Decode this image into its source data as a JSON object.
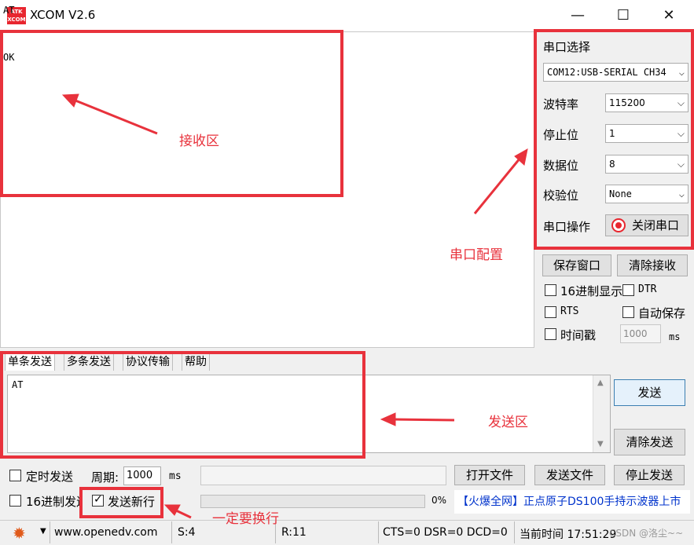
{
  "window": {
    "title": "XCOM V2.6",
    "logo_text": "ATK\nXCOM",
    "minimize": "—",
    "maximize": "☐",
    "close": "✕"
  },
  "receive": {
    "text": "AT\n\n\n\nOK"
  },
  "serial": {
    "port_label": "串口选择",
    "port_value": "COM12:USB-SERIAL CH34",
    "baud_label": "波特率",
    "baud_value": "115200",
    "stop_label": "停止位",
    "stop_value": "1",
    "data_label": "数据位",
    "data_value": "8",
    "parity_label": "校验位",
    "parity_value": "None",
    "op_label": "串口操作",
    "op_button": "关闭串口"
  },
  "receive_controls": {
    "save_window": "保存窗口",
    "clear_receive": "清除接收",
    "hex_display": "16进制显示",
    "dtr": "DTR",
    "rts": "RTS",
    "auto_save": "自动保存",
    "timestamp": "时间戳",
    "timestamp_value": "1000",
    "ms": "ms"
  },
  "tabs": [
    {
      "label": "单条发送"
    },
    {
      "label": "多条发送"
    },
    {
      "label": "协议传输"
    },
    {
      "label": "帮助"
    }
  ],
  "send": {
    "text": "AT",
    "send_button": "发送",
    "clear_send": "清除发送",
    "timed_send": "定时发送",
    "period_label": "周期:",
    "period_value": "1000",
    "ms": "ms",
    "hex_send": "16进制发送",
    "send_newline": "发送新行",
    "open_file": "打开文件",
    "send_file": "发送文件",
    "stop_send": "停止发送",
    "progress": "0%",
    "ad_text": "【火爆全网】正点原子DS100手持示波器上市"
  },
  "status": {
    "site": "www.openedv.com",
    "sent": "S:4",
    "recv": "R:11",
    "lines": "CTS=0 DSR=0 DCD=0",
    "time": "当前时间 17:51:29",
    "watermark": "CSDN @洛尘~~"
  },
  "annotations": {
    "receive": "接收区",
    "serial": "串口配置",
    "send": "发送区",
    "newline": "一定要换行"
  },
  "colors": {
    "annotation": "#e8323c",
    "link": "#0033cc"
  }
}
